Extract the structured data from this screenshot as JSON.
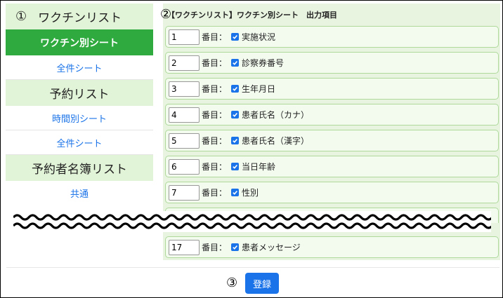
{
  "sidebar": {
    "section1": {
      "marker": "①",
      "title": "ワクチンリスト"
    },
    "active_item": "ワクチン別シート",
    "link_all1": "全件シート",
    "section2": "予約リスト",
    "link_time": "時間別シート",
    "link_all2": "全件シート",
    "section3": "予約者名簿リスト",
    "link_common": "共通"
  },
  "panel": {
    "marker": "②",
    "title": "【ワクチンリスト】ワクチン別シート　出力項目",
    "order_suffix": "番目：",
    "rows": [
      {
        "order": "1",
        "label": "実施状況",
        "checked": true
      },
      {
        "order": "2",
        "label": "診察券番号",
        "checked": true
      },
      {
        "order": "3",
        "label": "生年月日",
        "checked": true
      },
      {
        "order": "4",
        "label": "患者氏名（カナ）",
        "checked": true
      },
      {
        "order": "5",
        "label": "患者氏名（漢字）",
        "checked": true
      },
      {
        "order": "6",
        "label": "当日年齢",
        "checked": true
      },
      {
        "order": "7",
        "label": "性別",
        "checked": true
      },
      {
        "order": "17",
        "label": "患者メッセージ",
        "checked": true
      }
    ]
  },
  "footer": {
    "marker": "③",
    "register_label": "登録"
  },
  "colors": {
    "accent": "#1a73e8",
    "active": "#2eaa3e",
    "section_bg": "#e2f4d8"
  }
}
